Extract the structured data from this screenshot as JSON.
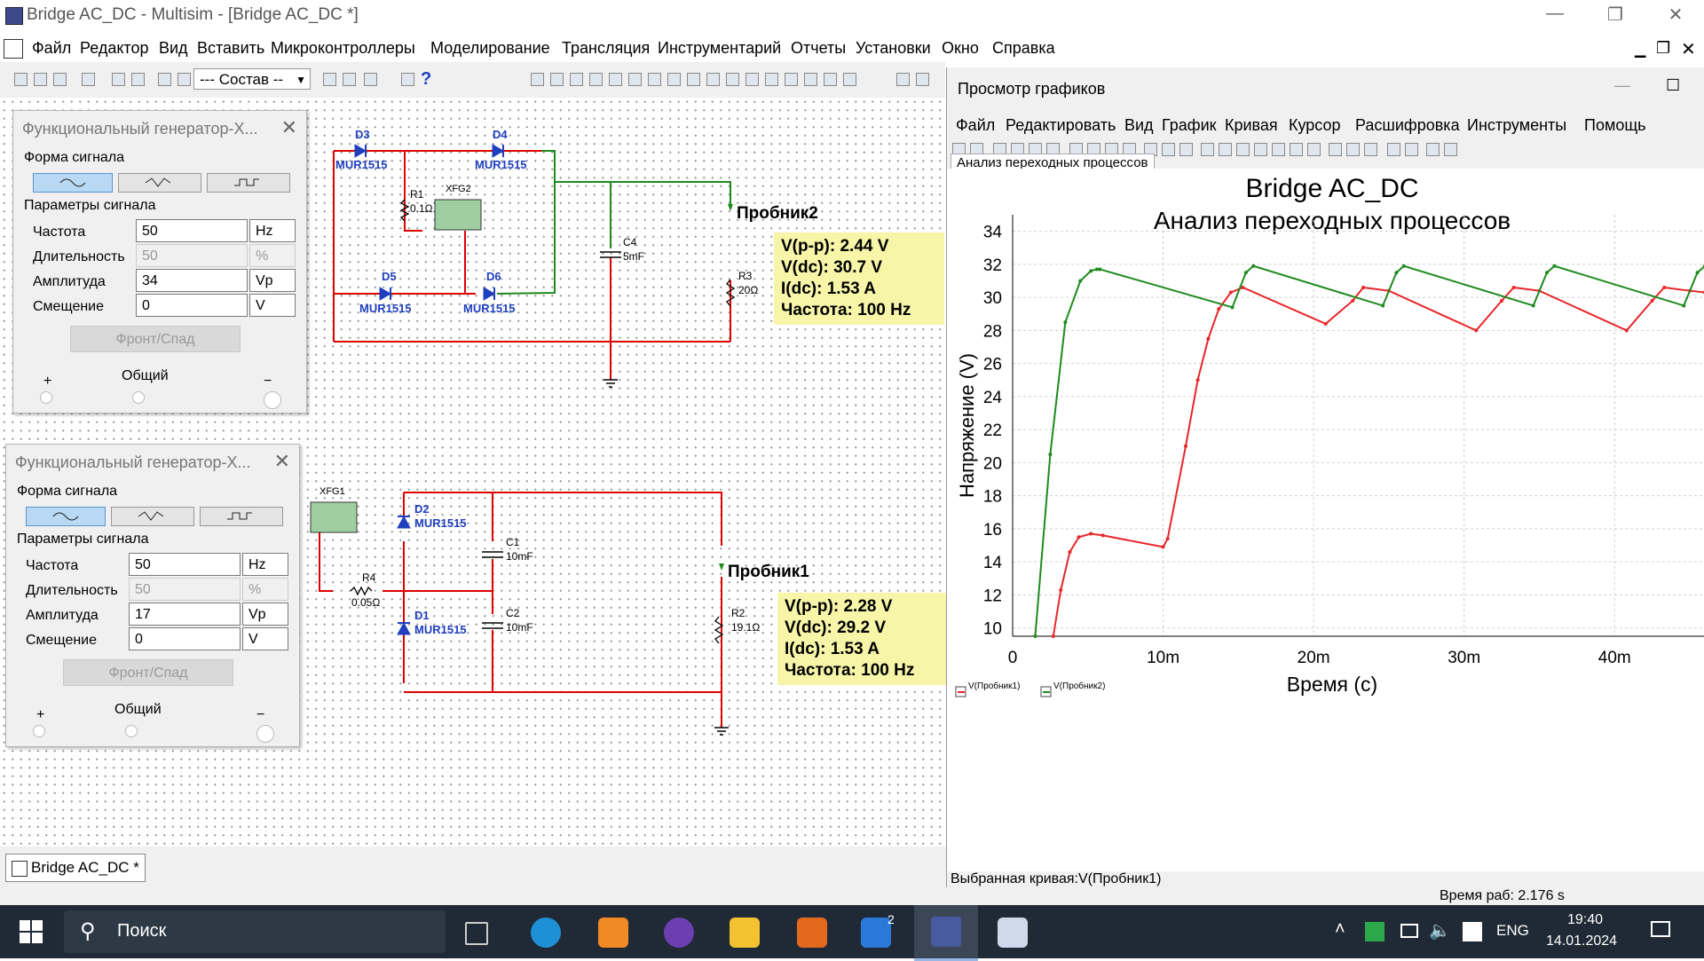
{
  "window": {
    "title": "Bridge AC_DC - Multisim - [Bridge AC_DC *]"
  },
  "menu": [
    "Файл",
    "Редактор",
    "Вид",
    "Вставить",
    "Микроконтроллеры",
    "Моделирование",
    "Трансляция",
    "Инструментарий",
    "Отчеты",
    "Установки",
    "Окно",
    "Справка"
  ],
  "toolbar": {
    "component_combo": "--- Состав --"
  },
  "generators": [
    {
      "title": "Функциональный генератор-X...",
      "waveform_label": "Форма сигнала",
      "params_label": "Параметры сигнала",
      "rows": [
        {
          "label": "Частота",
          "value": "50",
          "unit": "Hz"
        },
        {
          "label": "Длительность",
          "value": "50",
          "unit": "%"
        },
        {
          "label": "Амплитуда",
          "value": "34",
          "unit": "Vp"
        },
        {
          "label": "Смещение",
          "value": "0",
          "unit": "V"
        }
      ],
      "edge_button": "Фронт/Спад",
      "plus": "+",
      "common": "Общий",
      "minus": "−"
    },
    {
      "title": "Функциональный генератор-X...",
      "waveform_label": "Форма сигнала",
      "params_label": "Параметры сигнала",
      "rows": [
        {
          "label": "Частота",
          "value": "50",
          "unit": "Hz"
        },
        {
          "label": "Длительность",
          "value": "50",
          "unit": "%"
        },
        {
          "label": "Амплитуда",
          "value": "17",
          "unit": "Vp"
        },
        {
          "label": "Смещение",
          "value": "0",
          "unit": "V"
        }
      ],
      "edge_button": "Фронт/Спад",
      "plus": "+",
      "common": "Общий",
      "minus": "−"
    }
  ],
  "schematic": {
    "top": {
      "diodes": [
        {
          "ref": "D3",
          "model": "MUR1515"
        },
        {
          "ref": "D4",
          "model": "MUR1515"
        },
        {
          "ref": "D5",
          "model": "MUR1515"
        },
        {
          "ref": "D6",
          "model": "MUR1515"
        }
      ],
      "r1": {
        "ref": "R1",
        "value": "0.1Ω"
      },
      "xfg": "XFG2",
      "c4": {
        "ref": "C4",
        "value": "5mF"
      },
      "r3": {
        "ref": "R3",
        "value": "20Ω"
      },
      "probe": "Пробник2",
      "readout": [
        "V(p-p): 2.44 V",
        "V(dc): 30.7 V",
        "I(dc): 1.53 A",
        "Частота: 100 Hz"
      ]
    },
    "bottom": {
      "xfg": "XFG1",
      "d2": {
        "ref": "D2",
        "model": "MUR1515"
      },
      "d1": {
        "ref": "D1",
        "model": "MUR1515"
      },
      "r4": {
        "ref": "R4",
        "value": "0.05Ω"
      },
      "c1": {
        "ref": "C1",
        "value": "10mF"
      },
      "c2": {
        "ref": "C2",
        "value": "10mF"
      },
      "r2": {
        "ref": "R2",
        "value": "19.1Ω"
      },
      "probe": "Пробник1",
      "readout": [
        "V(p-p): 2.28 V",
        "V(dc): 29.2 V",
        "I(dc): 1.53 A",
        "Частота: 100 Hz"
      ]
    }
  },
  "tabs": {
    "design": "Bridge AC_DC *"
  },
  "grapher": {
    "title": "Просмотр графиков",
    "menu": [
      "Файл",
      "Редактировать",
      "Вид",
      "График",
      "Кривая",
      "Курсор",
      "Расшифровка",
      "Инструменты",
      "Помощь"
    ],
    "tab": "Анализ переходных процессов",
    "selected_curve": "Выбранная кривая:V(Пробник1)"
  },
  "chart_data": {
    "type": "line",
    "title": "Bridge AC_DC",
    "subtitle": "Анализ переходных процессов",
    "xlabel": "Время (с)",
    "ylabel": "Напряжение (V)",
    "xlim": [
      0,
      0.046
    ],
    "ylim": [
      9.5,
      35
    ],
    "xticks": [
      0,
      0.01,
      0.02,
      0.03,
      0.04
    ],
    "xtick_labels": [
      "0",
      "10m",
      "20m",
      "30m",
      "40m"
    ],
    "yticks": [
      10,
      12,
      14,
      16,
      18,
      20,
      22,
      24,
      26,
      28,
      30,
      32,
      34
    ],
    "grid": true,
    "legend_position": "bottom-left",
    "series": [
      {
        "name": "V(Пробник1)",
        "color": "#e8262a",
        "x": [
          0.0027,
          0.0032,
          0.0038,
          0.0044,
          0.0052,
          0.006,
          0.01,
          0.0103,
          0.0115,
          0.0123,
          0.013,
          0.0137,
          0.0145,
          0.0153,
          0.0208,
          0.0226,
          0.0233,
          0.025,
          0.0308,
          0.0325,
          0.0333,
          0.035,
          0.0408,
          0.0425,
          0.0433,
          0.045,
          0.046
        ],
        "y": [
          9.5,
          12.3,
          14.6,
          15.5,
          15.7,
          15.6,
          14.9,
          15.4,
          21.0,
          25.0,
          27.5,
          29.3,
          30.3,
          30.6,
          28.4,
          29.8,
          30.6,
          30.4,
          28.0,
          29.8,
          30.6,
          30.4,
          28.0,
          29.8,
          30.6,
          30.4,
          30.3
        ]
      },
      {
        "name": "V(Пробник2)",
        "color": "#1e8a1e",
        "x": [
          0.0015,
          0.0025,
          0.0035,
          0.0045,
          0.0052,
          0.0056,
          0.0058,
          0.0146,
          0.0155,
          0.016,
          0.0246,
          0.0255,
          0.026,
          0.0346,
          0.0355,
          0.036,
          0.0446,
          0.0455,
          0.046
        ],
        "y": [
          9.5,
          20.5,
          28.5,
          31.0,
          31.6,
          31.7,
          31.7,
          29.4,
          31.5,
          31.9,
          29.5,
          31.5,
          31.9,
          29.5,
          31.5,
          31.9,
          29.5,
          31.5,
          31.9
        ]
      }
    ]
  },
  "status": {
    "sim_time": "Время раб: 2.176 s"
  },
  "taskbar": {
    "search": "Поиск",
    "lang": "ENG",
    "time": "19:40",
    "date": "14.01.2024",
    "badge": "2"
  },
  "colors": {
    "wire_red": "#e00000",
    "wire_green": "#1e8a1e",
    "component_blue": "#1f3fbf",
    "readout_bg": "#f7f5a8"
  }
}
